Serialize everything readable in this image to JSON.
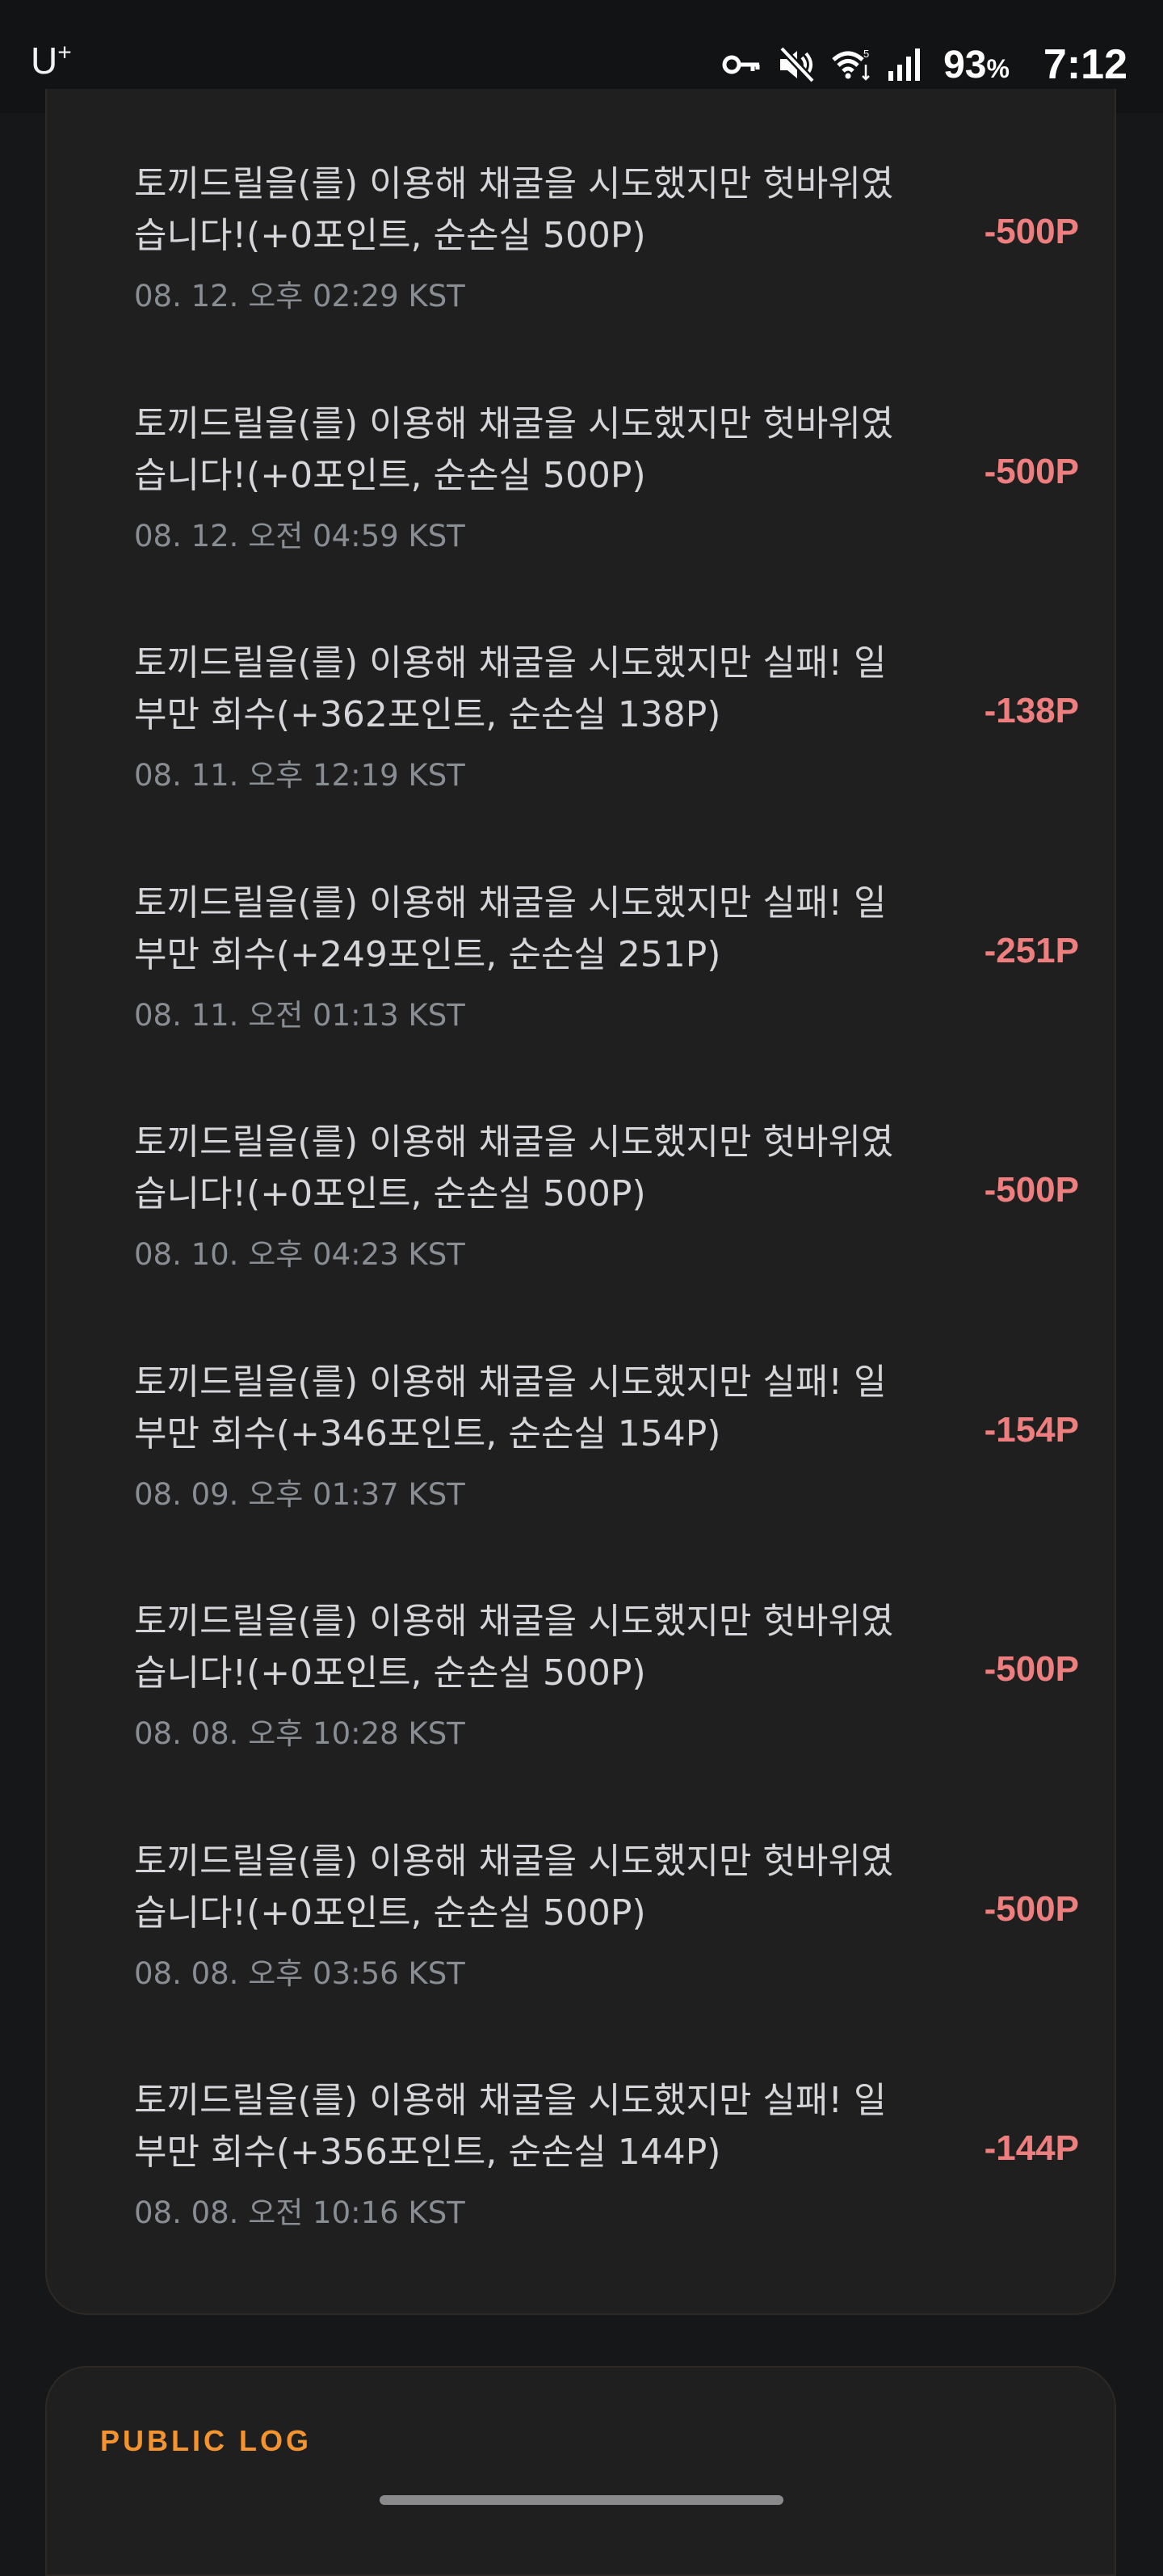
{
  "status_bar": {
    "carrier": "U",
    "carrier_sup": "+",
    "battery": "93",
    "battery_unit": "%",
    "time": "7:12",
    "icons": [
      "key-icon",
      "mute-icon",
      "wifi-icon",
      "signal-icon"
    ]
  },
  "log": {
    "items": [
      {
        "text": "토끼드릴을(를) 이용해 채굴을 시도했지만 헛바위였습니다!(+0포인트, 순손실 500P)",
        "time": "08. 12. 오후 02:29 KST",
        "amount": "-500P"
      },
      {
        "text": "토끼드릴을(를) 이용해 채굴을 시도했지만 헛바위였습니다!(+0포인트, 순손실 500P)",
        "time": "08. 12. 오전 04:59 KST",
        "amount": "-500P"
      },
      {
        "text": "토끼드릴을(를) 이용해 채굴을 시도했지만 실패! 일부만 회수(+362포인트, 순손실 138P)",
        "time": "08. 11. 오후 12:19 KST",
        "amount": "-138P"
      },
      {
        "text": "토끼드릴을(를) 이용해 채굴을 시도했지만 실패! 일부만 회수(+249포인트, 순손실 251P)",
        "time": "08. 11. 오전 01:13 KST",
        "amount": "-251P"
      },
      {
        "text": "토끼드릴을(를) 이용해 채굴을 시도했지만 헛바위였습니다!(+0포인트, 순손실 500P)",
        "time": "08. 10. 오후 04:23 KST",
        "amount": "-500P"
      },
      {
        "text": "토끼드릴을(를) 이용해 채굴을 시도했지만 실패! 일부만 회수(+346포인트, 순손실 154P)",
        "time": "08. 09. 오후 01:37 KST",
        "amount": "-154P"
      },
      {
        "text": "토끼드릴을(를) 이용해 채굴을 시도했지만 헛바위였습니다!(+0포인트, 순손실 500P)",
        "time": "08. 08. 오후 10:28 KST",
        "amount": "-500P"
      },
      {
        "text": "토끼드릴을(를) 이용해 채굴을 시도했지만 헛바위였습니다!(+0포인트, 순손실 500P)",
        "time": "08. 08. 오후 03:56 KST",
        "amount": "-500P"
      },
      {
        "text": "토끼드릴을(를) 이용해 채굴을 시도했지만 실패! 일부만 회수(+356포인트, 순손실 144P)",
        "time": "08. 08. 오전 10:16 KST",
        "amount": "-144P"
      }
    ]
  },
  "public_log": {
    "title": "PUBLIC LOG"
  },
  "colors": {
    "amount_negative": "#ef7f7f",
    "section_title": "#f5942e",
    "card_bg": "#1f1f20",
    "page_bg": "#161718"
  }
}
